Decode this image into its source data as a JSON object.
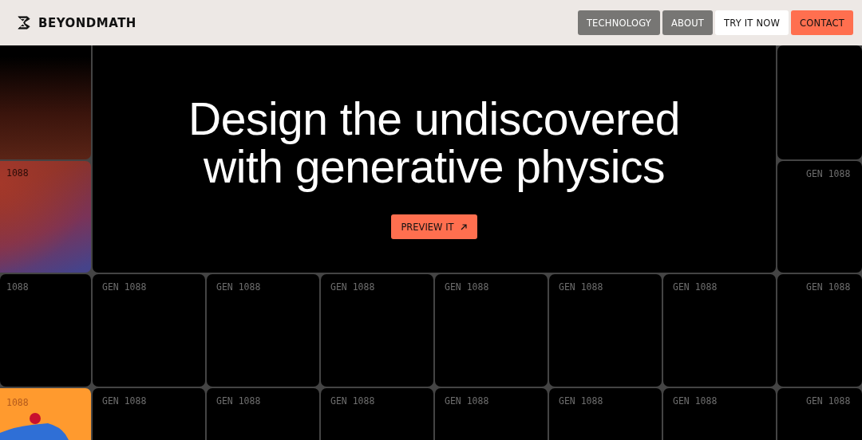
{
  "header": {
    "logo": "BEYONDMATH",
    "nav": [
      {
        "label": "TECHNOLOGY",
        "kind": "muted"
      },
      {
        "label": "ABOUT",
        "kind": "muted"
      },
      {
        "label": "TRY IT NOW",
        "kind": "light"
      },
      {
        "label": "CONTACT",
        "kind": "accent"
      }
    ]
  },
  "hero": {
    "title_lines": [
      "Design the undiscovered",
      "with generative physics"
    ],
    "button": "PREVIEW IT"
  },
  "grid_rows": [
    [
      {
        "kind": "gradient-dark"
      },
      {
        "kind": "plain"
      }
    ],
    [
      {
        "kind": "gradient-warm",
        "label": "1088"
      },
      {
        "kind": "plain",
        "label": "GEN 1088"
      }
    ],
    [
      {
        "kind": "plain",
        "label": "1088"
      },
      {
        "kind": "plain",
        "label": "GEN 1088"
      },
      {
        "kind": "plain",
        "label": "GEN 1088"
      },
      {
        "kind": "plain",
        "label": "GEN 1088"
      },
      {
        "kind": "plain",
        "label": "GEN 1088"
      },
      {
        "kind": "plain",
        "label": "GEN 1088"
      },
      {
        "kind": "plain",
        "label": "GEN 1088"
      },
      {
        "kind": "plain",
        "label": "GEN 1088"
      }
    ],
    [
      {
        "kind": "image",
        "label": "1088"
      },
      {
        "kind": "plain",
        "label": "GEN 1088"
      },
      {
        "kind": "plain",
        "label": "GEN 1088"
      },
      {
        "kind": "plain",
        "label": "GEN 1088"
      },
      {
        "kind": "plain",
        "label": "GEN 1088"
      },
      {
        "kind": "plain",
        "label": "GEN 1088"
      },
      {
        "kind": "plain",
        "label": "GEN 1088"
      },
      {
        "kind": "plain",
        "label": "GEN 1088"
      }
    ]
  ]
}
